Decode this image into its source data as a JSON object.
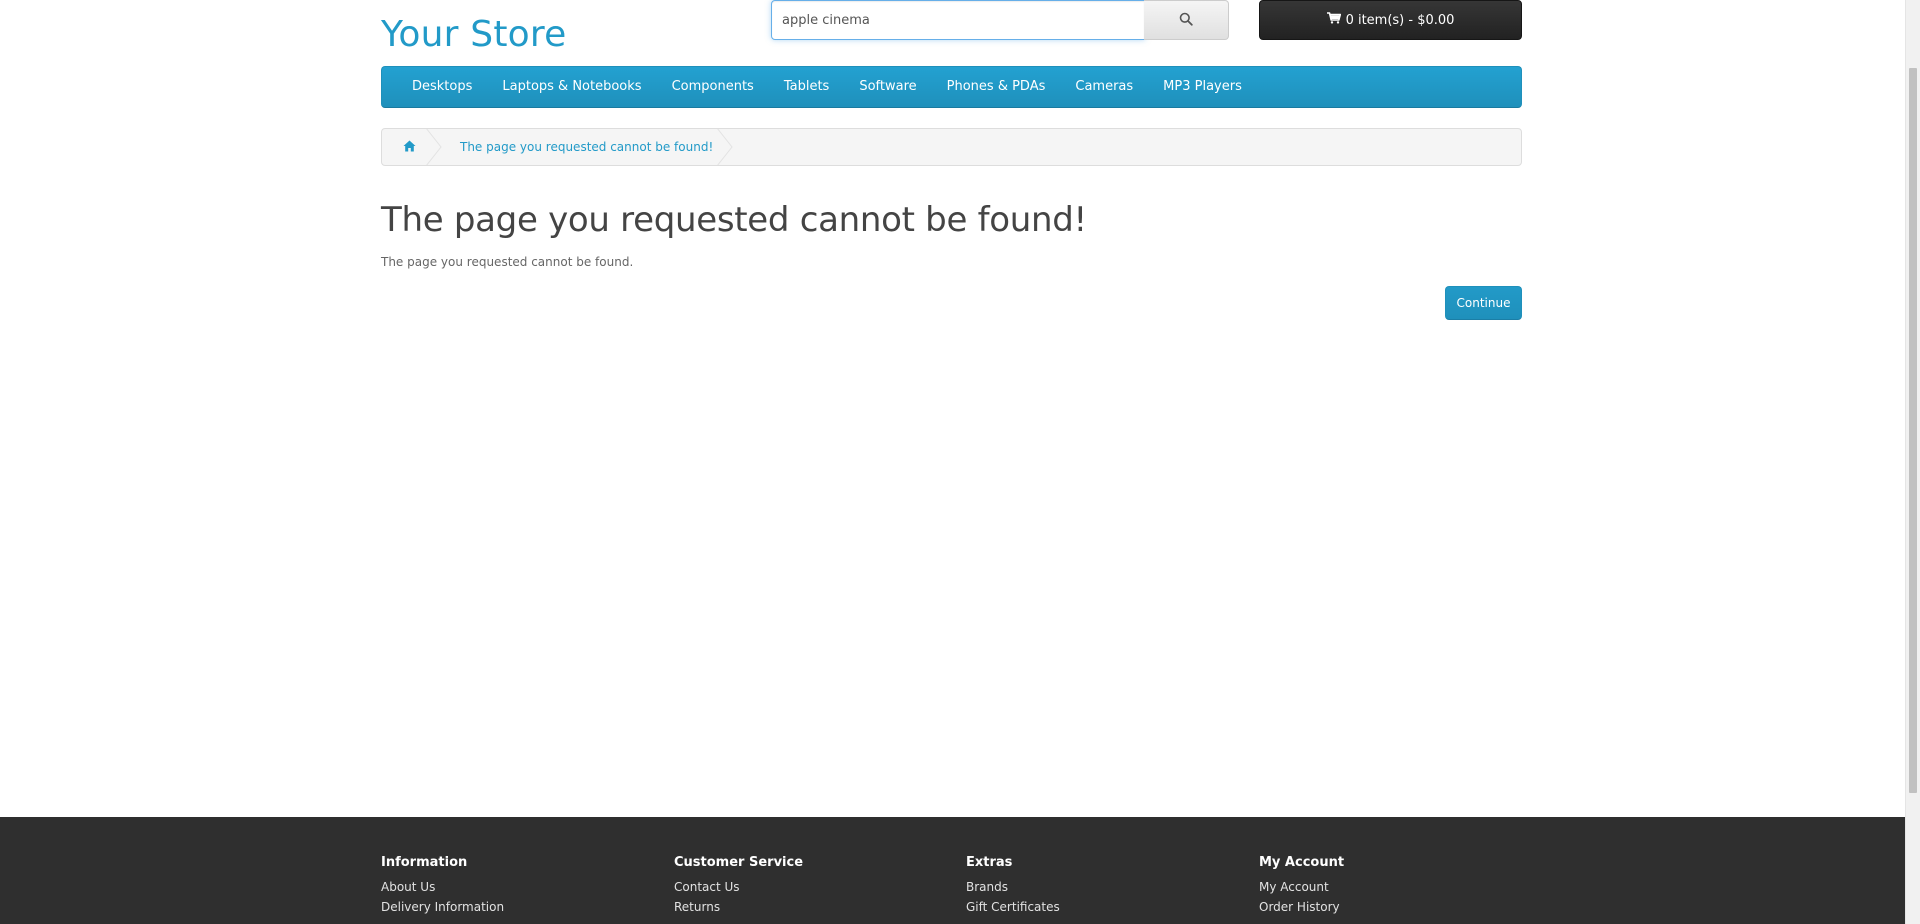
{
  "header": {
    "logo_text": "Your Store",
    "search": {
      "value": "apple cinema",
      "placeholder": "Search",
      "button_icon": "search-icon"
    },
    "cart": {
      "icon": "shopping-cart-icon",
      "label": "0 item(s) - $0.00"
    }
  },
  "menu": {
    "items": [
      {
        "label": "Desktops"
      },
      {
        "label": "Laptops & Notebooks"
      },
      {
        "label": "Components"
      },
      {
        "label": "Tablets"
      },
      {
        "label": "Software"
      },
      {
        "label": "Phones & PDAs"
      },
      {
        "label": "Cameras"
      },
      {
        "label": "MP3 Players"
      }
    ]
  },
  "breadcrumb": {
    "home_icon": "home-icon",
    "current": "The page you requested cannot be found!"
  },
  "content": {
    "heading": "The page you requested cannot be found!",
    "message": "The page you requested cannot be found.",
    "continue_label": "Continue"
  },
  "footer": {
    "columns": [
      {
        "title": "Information",
        "links": [
          "About Us",
          "Delivery Information"
        ]
      },
      {
        "title": "Customer Service",
        "links": [
          "Contact Us",
          "Returns"
        ]
      },
      {
        "title": "Extras",
        "links": [
          "Brands",
          "Gift Certificates"
        ]
      },
      {
        "title": "My Account",
        "links": [
          "My Account",
          "Order History"
        ]
      }
    ]
  },
  "colors": {
    "brand_blue": "#229ac8",
    "cart_dark": "#222222",
    "footer_bg": "#2f2f2f"
  }
}
